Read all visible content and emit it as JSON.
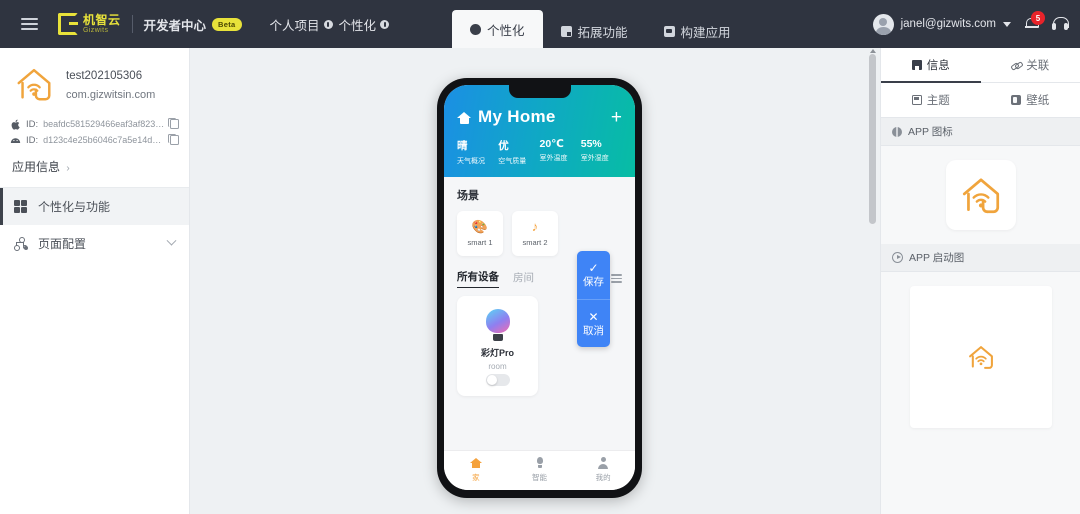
{
  "topbar": {
    "menu_icon": "hamburger-icon",
    "brand_cn": "机智云",
    "brand_en": "Gizwits",
    "dev_center": "开发者中心",
    "beta_badge": "Beta",
    "breadcrumbs": [
      {
        "label": "个人项目",
        "icon": "info-dot-icon"
      },
      {
        "label": "个性化",
        "icon": "info-dot-icon"
      }
    ],
    "tabs": [
      {
        "label": "个性化",
        "icon": "palette-icon",
        "active": true
      },
      {
        "label": "拓展功能",
        "icon": "extension-icon",
        "active": false
      },
      {
        "label": "构建应用",
        "icon": "build-icon",
        "active": false
      }
    ],
    "user_email": "janel@gizwits.com",
    "notification_count": "5",
    "support_icon": "headset-icon"
  },
  "sidebar": {
    "app_name": "test202105306",
    "app_package": "com.gizwitsin.com",
    "ids": [
      {
        "platform": "apple-icon",
        "label": "ID:",
        "value": "beafdc581529466eaf3af82370946..."
      },
      {
        "platform": "android-icon",
        "label": "ID:",
        "value": "d123c4e25b6046c7a5e14daa1137..."
      }
    ],
    "app_info_link": "应用信息",
    "app_info_arrow": "›",
    "nav": [
      {
        "label": "个性化与功能",
        "icon": "grid-icon",
        "active": true,
        "chevron": false
      },
      {
        "label": "页面配置",
        "icon": "sitemap-icon",
        "active": false,
        "chevron": true
      }
    ]
  },
  "canvas": {
    "actions": [
      {
        "label": "保存",
        "glyph": "✓",
        "name": "save"
      },
      {
        "label": "取消",
        "glyph": "✕",
        "name": "cancel"
      }
    ],
    "phone": {
      "header": {
        "title": "My Home",
        "home_icon": "home-icon",
        "add_icon": "+",
        "stats": [
          {
            "value": "晴",
            "label": "天气概况"
          },
          {
            "value": "优",
            "label": "空气质量"
          },
          {
            "value": "20℃",
            "label": "室外温度"
          },
          {
            "value": "55%",
            "label": "室外湿度"
          }
        ]
      },
      "scenes": {
        "title": "场景",
        "items": [
          {
            "label": "smart 1",
            "icon": "palette-icon",
            "glyph": "🎨"
          },
          {
            "label": "smart 2",
            "icon": "music-note-icon",
            "glyph": "♪"
          }
        ]
      },
      "devices": {
        "tabs": [
          {
            "label": "所有设备",
            "active": true
          },
          {
            "label": "房间",
            "active": false
          }
        ],
        "view_toggle_icon": "list-view-icon",
        "items": [
          {
            "name": "彩灯Pro",
            "room": "room",
            "icon": "bulb-icon",
            "toggle_on": false
          }
        ]
      },
      "bottom_nav": [
        {
          "label": "家",
          "icon": "home-icon",
          "active": true
        },
        {
          "label": "智能",
          "icon": "bulb-icon",
          "active": false
        },
        {
          "label": "我的",
          "icon": "user-icon",
          "active": false
        }
      ]
    }
  },
  "right_panel": {
    "tabs_row1": [
      {
        "label": "信息",
        "icon": "info-icon",
        "active": true
      },
      {
        "label": "关联",
        "icon": "link-icon",
        "active": false
      }
    ],
    "tabs_row2": [
      {
        "label": "主题",
        "icon": "theme-icon",
        "active": false
      },
      {
        "label": "壁纸",
        "icon": "wallpaper-icon",
        "active": false
      }
    ],
    "sections": [
      {
        "title": "APP 图标",
        "icon": "globe-icon"
      },
      {
        "title": "APP 启动图",
        "icon": "play-icon"
      }
    ]
  },
  "colors": {
    "topbar_bg": "#2f3440",
    "brand_yellow": "#e8e23a",
    "accent_blue": "#3f84f6",
    "accent_orange": "#f5a23c",
    "badge_red": "#e8232a",
    "phone_header_from": "#1b8fe4",
    "phone_header_to": "#07bda4",
    "canvas_bg": "#eef1f3"
  }
}
